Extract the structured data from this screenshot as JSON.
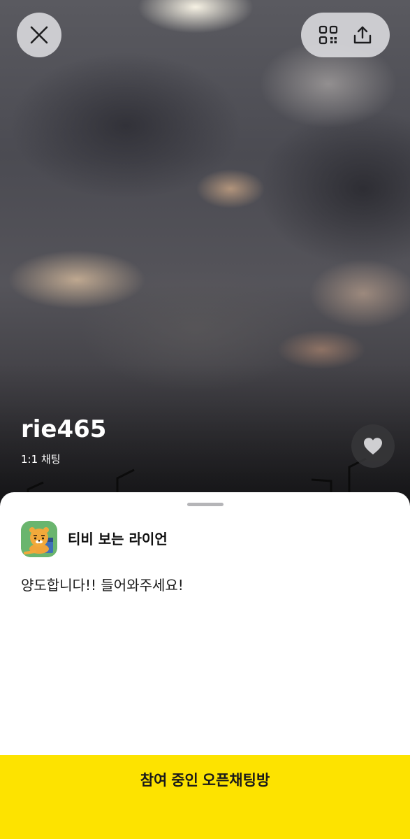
{
  "room": {
    "title": "rie465",
    "type_label": "1:1 채팅"
  },
  "header": {
    "close_icon": "close-icon",
    "qr_icon": "qr-code-icon",
    "share_icon": "share-icon"
  },
  "favorite": {
    "icon": "heart-icon"
  },
  "host": {
    "name": "티비 보는 라이언",
    "avatar": "ryan-character-avatar"
  },
  "description": "양도합니다!! 들어와주세요!",
  "join_button": {
    "label": "참여 중인 오픈채팅방"
  },
  "colors": {
    "accent_yellow": "#fde300",
    "sheet_bg": "#ffffff",
    "avatar_green": "#6ab56e"
  }
}
